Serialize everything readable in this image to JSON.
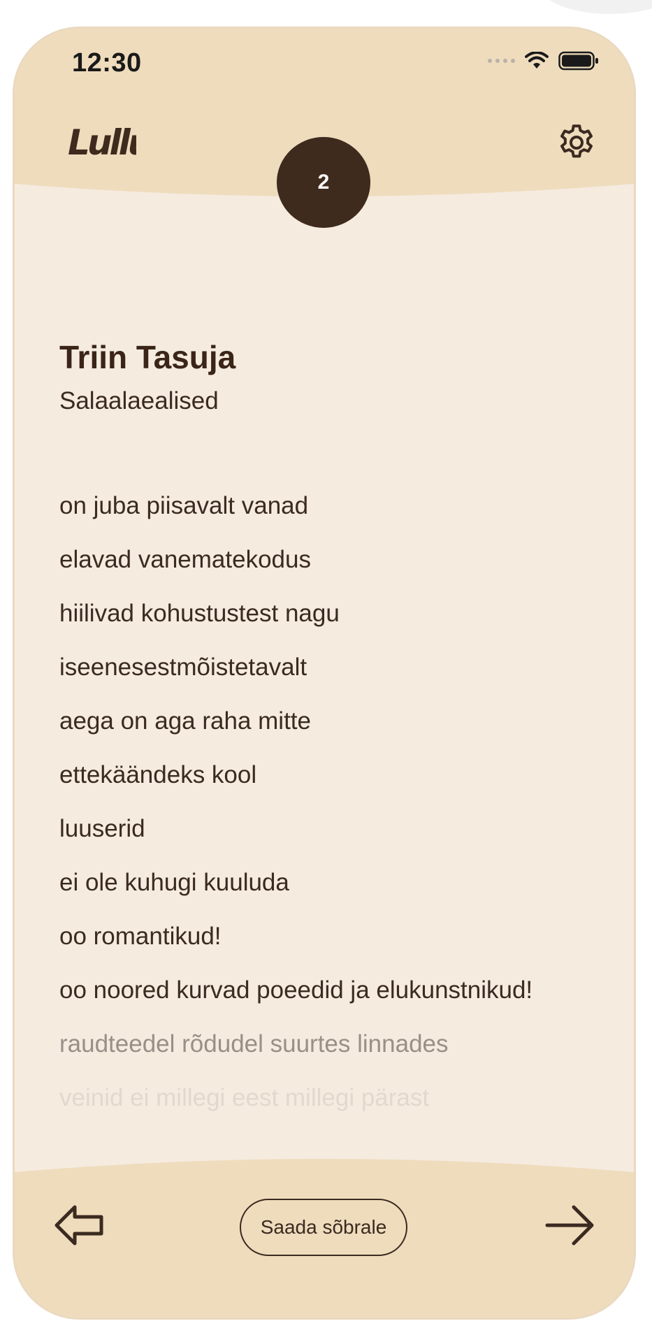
{
  "status_bar": {
    "time": "12:30",
    "icons": [
      "cellular-signal-icon",
      "wifi-icon",
      "battery-icon"
    ]
  },
  "header": {
    "logo_text": "Lullu",
    "settings_icon": "gear-icon",
    "page_number": "2"
  },
  "poem": {
    "author": "Triin Tasuja",
    "title": "Salaalaealised",
    "lines": [
      "on juba piisavalt vanad",
      "elavad vanematekodus",
      "hiilivad kohustustest nagu",
      "iseenesestmõistetavalt",
      "aega on aga raha mitte",
      "ettekäändeks kool",
      "luuserid",
      "ei ole kuhugi kuuluda",
      "oo romantikud!",
      "oo noored kurvad poeedid ja elukunstnikud!",
      "raudteedel rõdudel suurtes linnades",
      "veinid ei millegi eest millegi pärast"
    ]
  },
  "footer": {
    "prev_icon": "arrow-left-icon",
    "share_label": "Saada sõbrale",
    "next_icon": "arrow-right-icon"
  },
  "colors": {
    "band": "#efdcbd",
    "paper": "#f5ebdf",
    "ink": "#3a2a20",
    "badge": "#3f2a1e"
  }
}
